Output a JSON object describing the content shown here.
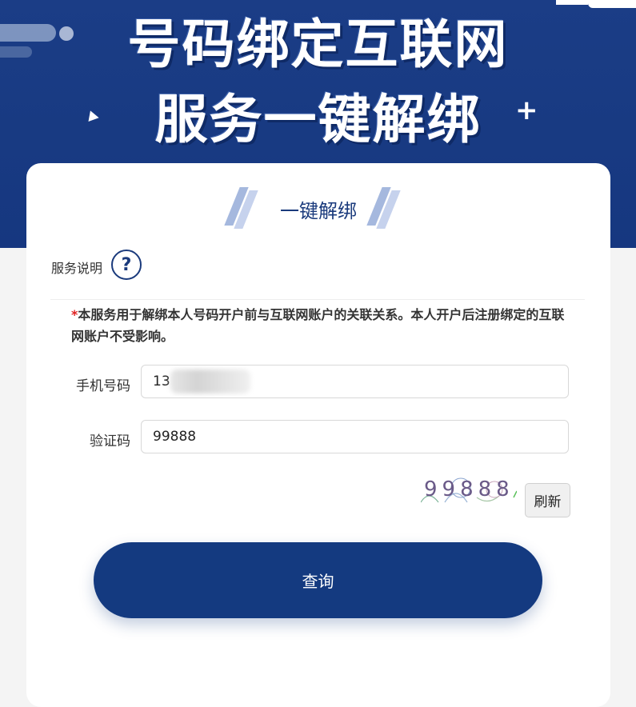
{
  "banner": {
    "line1": "号码绑定互联网",
    "line2": "服务一键解绑",
    "plus": "+"
  },
  "card": {
    "title": "一键解绑",
    "service_label": "服务说明",
    "help_glyph": "?",
    "notice_star": "*",
    "notice": "本服务用于解绑本人号码开户前与互联网账户的关联关系。本人开户后注册绑定的互联网账户不受影响。"
  },
  "form": {
    "phone_label": "手机号码",
    "phone_value": "13",
    "code_label": "验证码",
    "code_value": "99888",
    "captcha_text": "99888",
    "refresh_label": "刷新",
    "submit_label": "查询"
  },
  "colors": {
    "brand": "#143a80",
    "banner": "#1b3d86",
    "required": "#e02020"
  }
}
